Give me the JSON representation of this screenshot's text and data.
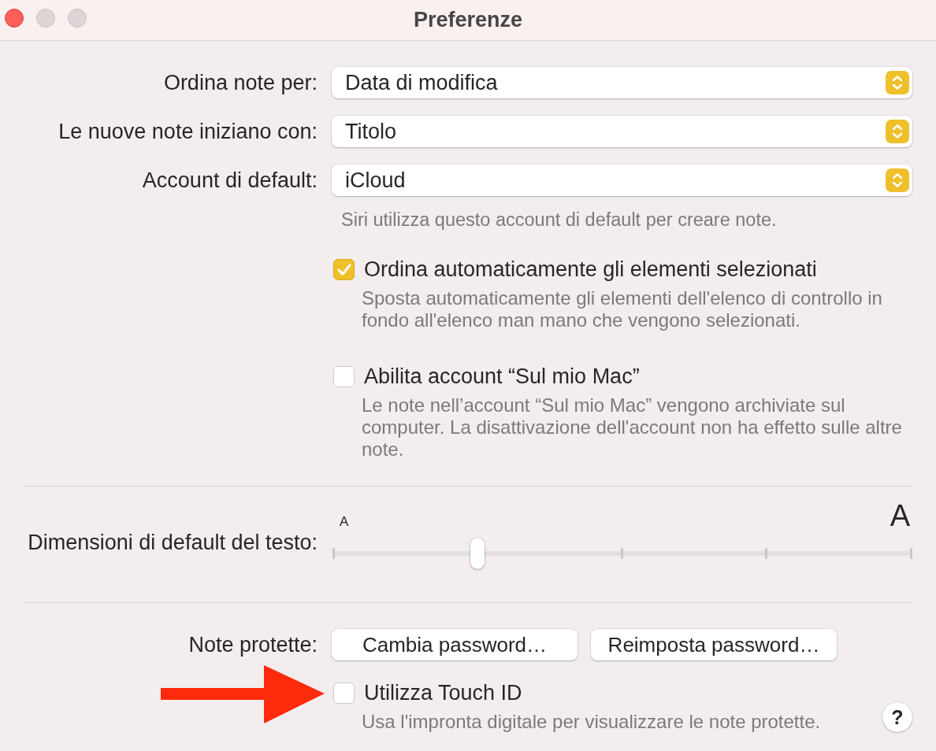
{
  "window": {
    "title": "Preferenze",
    "controls": [
      {
        "kind": "close",
        "disabled": false
      },
      {
        "kind": "minimize",
        "disabled": true
      },
      {
        "kind": "zoom",
        "disabled": true
      }
    ]
  },
  "popups": [
    {
      "label": "Ordina note per:",
      "value": "Data di modifica"
    },
    {
      "label": "Le nuove note iniziano con:",
      "value": "Titolo"
    },
    {
      "label": "Account di default:",
      "value": "iCloud",
      "hint": "Siri utilizza questo account di default per creare note."
    }
  ],
  "options": [
    {
      "label": "Ordina automaticamente gli elementi selezionati",
      "checked": true,
      "description": "Sposta automaticamente gli elementi dell'elenco di controllo in fondo all'elenco man mano che vengono selezionati."
    },
    {
      "label": "Abilita account “Sul mio Mac”",
      "checked": false,
      "description": "Le note nell’account “Sul mio Mac” vengono archiviate sul computer. La disattivazione dell'account non ha effetto sulle altre note."
    }
  ],
  "text_size": {
    "label": "Dimensioni di default del testo:",
    "min_label": "A",
    "max_label": "A",
    "level": 0.25
  },
  "protected_notes": {
    "label": "Note protette:",
    "buttons": [
      "Cambia password…",
      "Reimposta password…"
    ],
    "touch_id": {
      "label": "Utilizza Touch ID",
      "checked": false,
      "description": "Usa l'impronta digitale per visualizzare le note protette."
    }
  },
  "help_button": "?",
  "annotation": {
    "kind": "arrow"
  }
}
